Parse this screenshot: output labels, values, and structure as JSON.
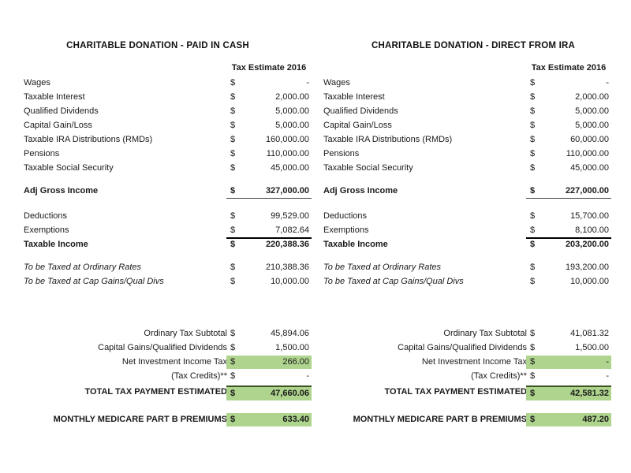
{
  "document": {
    "kind": "spreadsheet-comparison",
    "background_color": "#ffffff",
    "highlight_color": "#aed48e",
    "total_rule_color": "#3b5323"
  },
  "columns": [
    {
      "id": "paid-in-cash",
      "title": "CHARITABLE DONATION - PAID IN CASH",
      "header": "Tax Estimate 2016",
      "income_rows": [
        {
          "label": "Wages",
          "currency": "$",
          "amount": "-"
        },
        {
          "label": "Taxable Interest",
          "currency": "$",
          "amount": "2,000.00"
        },
        {
          "label": "Qualified Dividends",
          "currency": "$",
          "amount": "5,000.00"
        },
        {
          "label": "Capital Gain/Loss",
          "currency": "$",
          "amount": "5,000.00"
        },
        {
          "label": "Taxable IRA Distributions (RMDs)",
          "currency": "$",
          "amount": "160,000.00"
        },
        {
          "label": "Pensions",
          "currency": "$",
          "amount": "110,000.00"
        },
        {
          "label": "Taxable Social Security",
          "currency": "$",
          "amount": "45,000.00"
        }
      ],
      "agi": {
        "label": "Adj Gross Income",
        "currency": "$",
        "amount": "327,000.00"
      },
      "deductions": {
        "label": "Deductions",
        "currency": "$",
        "amount": "99,529.00"
      },
      "exemptions": {
        "label": "Exemptions",
        "currency": "$",
        "amount": "7,082.64"
      },
      "taxable_income": {
        "label": "Taxable Income",
        "currency": "$",
        "amount": "220,388.36"
      },
      "ordinary_rates": {
        "label": "To be Taxed at Ordinary Rates",
        "currency": "$",
        "amount": "210,388.36"
      },
      "cap_gains_rates": {
        "label": "To be Taxed at Cap Gains/Qual Divs",
        "currency": "$",
        "amount": "10,000.00"
      },
      "ordinary_subtotal": {
        "label": "Ordinary Tax Subtotal",
        "currency": "$",
        "amount": "45,894.06"
      },
      "cap_gains_qual_div": {
        "label": "Capital Gains/Qualified Dividends",
        "currency": "$",
        "amount": "1,500.00"
      },
      "niit": {
        "label": "Net Investment Income Tax",
        "currency": "$",
        "amount": "266.00"
      },
      "tax_credits": {
        "label": "(Tax Credits)**",
        "currency": "$",
        "amount": "-"
      },
      "total_tax": {
        "label": "TOTAL TAX PAYMENT ESTIMATED",
        "currency": "$",
        "amount": "47,660.06"
      },
      "medicare": {
        "label": "MONTHLY MEDICARE PART B PREMIUMS",
        "currency": "$",
        "amount": "633.40"
      }
    },
    {
      "id": "direct-from-ira",
      "title": "CHARITABLE DONATION - DIRECT FROM IRA",
      "header": "Tax Estimate 2016",
      "income_rows": [
        {
          "label": "Wages",
          "currency": "$",
          "amount": "-"
        },
        {
          "label": "Taxable Interest",
          "currency": "$",
          "amount": "2,000.00"
        },
        {
          "label": "Qualified Dividends",
          "currency": "$",
          "amount": "5,000.00"
        },
        {
          "label": "Capital Gain/Loss",
          "currency": "$",
          "amount": "5,000.00"
        },
        {
          "label": "Taxable IRA Distributions (RMDs)",
          "currency": "$",
          "amount": "60,000.00"
        },
        {
          "label": "Pensions",
          "currency": "$",
          "amount": "110,000.00"
        },
        {
          "label": "Taxable Social Security",
          "currency": "$",
          "amount": "45,000.00"
        }
      ],
      "agi": {
        "label": "Adj Gross Income",
        "currency": "$",
        "amount": "227,000.00"
      },
      "deductions": {
        "label": "Deductions",
        "currency": "$",
        "amount": "15,700.00"
      },
      "exemptions": {
        "label": "Exemptions",
        "currency": "$",
        "amount": "8,100.00"
      },
      "taxable_income": {
        "label": "Taxable Income",
        "currency": "$",
        "amount": "203,200.00"
      },
      "ordinary_rates": {
        "label": "To be Taxed at Ordinary Rates",
        "currency": "$",
        "amount": "193,200.00"
      },
      "cap_gains_rates": {
        "label": "To be Taxed at Cap Gains/Qual Divs",
        "currency": "$",
        "amount": "10,000.00"
      },
      "ordinary_subtotal": {
        "label": "Ordinary Tax Subtotal",
        "currency": "$",
        "amount": "41,081.32"
      },
      "cap_gains_qual_div": {
        "label": "Capital Gains/Qualified Dividends",
        "currency": "$",
        "amount": "1,500.00"
      },
      "niit": {
        "label": "Net Investment Income Tax",
        "currency": "$",
        "amount": "-"
      },
      "tax_credits": {
        "label": "(Tax Credits)**",
        "currency": "$",
        "amount": "-"
      },
      "total_tax": {
        "label": "TOTAL TAX PAYMENT ESTIMATED",
        "currency": "$",
        "amount": "42,581.32"
      },
      "medicare": {
        "label": "MONTHLY MEDICARE PART B PREMIUMS",
        "currency": "$",
        "amount": "487.20"
      }
    }
  ]
}
